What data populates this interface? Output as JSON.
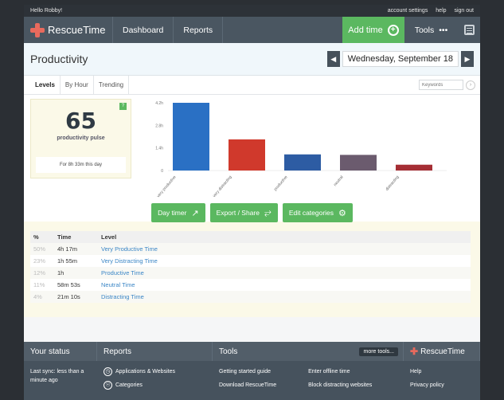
{
  "topbar": {
    "greeting": "Hello Robby!",
    "links": [
      "account settings",
      "help",
      "sign out"
    ]
  },
  "nav": {
    "brand": "RescueTime",
    "items": [
      "Dashboard",
      "Reports"
    ],
    "add_time": "Add time",
    "tools": "Tools",
    "tools_dots": "•••"
  },
  "page": {
    "title": "Productivity",
    "date": "Wednesday, September 18"
  },
  "tabs": [
    {
      "label": "Levels",
      "active": true
    },
    {
      "label": "By Hour",
      "active": false
    },
    {
      "label": "Trending",
      "active": false
    }
  ],
  "keywords_placeholder": "Keywords",
  "pulse": {
    "value": "65",
    "label": "productivity pulse",
    "note": "For 8h 33m this day"
  },
  "chart_data": {
    "type": "bar",
    "categories": [
      "very productive",
      "very distracting",
      "productive",
      "neutral",
      "distracting"
    ],
    "values": [
      4.28,
      1.93,
      1.0,
      0.97,
      0.36
    ],
    "ylim": [
      0,
      4.2
    ],
    "y_ticks": [
      "0",
      "1.4h",
      "2.8h",
      "4.2h"
    ],
    "colors": [
      "#2a70c4",
      "#d0392c",
      "#2d5ca3",
      "#6b5b6e",
      "#a52e34"
    ],
    "grid": false
  },
  "buttons": {
    "day_timer": "Day timer",
    "export": "Export / Share",
    "edit_categories": "Edit categories"
  },
  "table": {
    "headers": [
      "%",
      "Time",
      "Level"
    ],
    "rows": [
      {
        "pct": "50%",
        "time": "4h 17m",
        "level": "Very Productive Time"
      },
      {
        "pct": "23%",
        "time": "1h 55m",
        "level": "Very Distracting Time"
      },
      {
        "pct": "12%",
        "time": "1h",
        "level": "Productive Time"
      },
      {
        "pct": "11%",
        "time": "58m 53s",
        "level": "Neutral Time"
      },
      {
        "pct": "4%",
        "time": "21m 10s",
        "level": "Distracting Time"
      }
    ]
  },
  "footer": {
    "status_title": "Your status",
    "reports_title": "Reports",
    "tools_title": "Tools",
    "more_tools": "more tools...",
    "brand": "RescueTime",
    "last_sync": "Last sync: less than a minute ago",
    "report_links": [
      "Applications & Websites",
      "Categories"
    ],
    "tools_col1": [
      "Getting started guide",
      "Download RescueTime"
    ],
    "tools_col2": [
      "Enter offline time",
      "Block distracting websites"
    ],
    "brand_links": [
      "Help",
      "Privacy policy"
    ]
  }
}
